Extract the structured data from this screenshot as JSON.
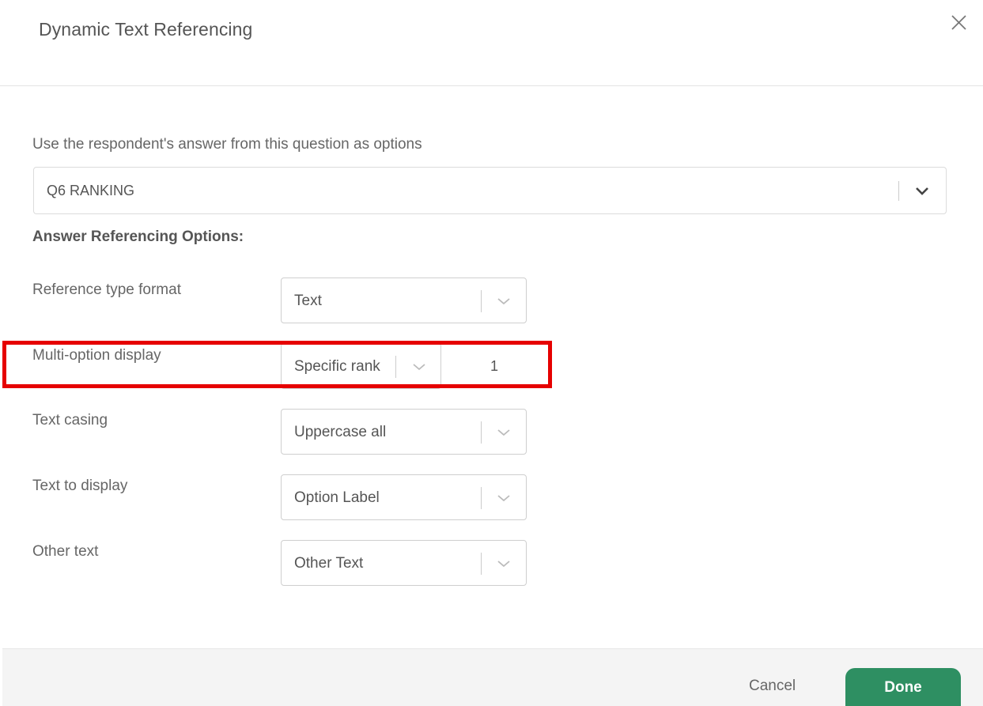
{
  "dialog": {
    "title": "Dynamic Text Referencing",
    "close_icon": "close-icon"
  },
  "question": {
    "label": "Use the respondent's answer from this question as options",
    "selected": "Q6 RANKING"
  },
  "options_section": {
    "title": "Answer Referencing Options:",
    "reference_type": {
      "label": "Reference type format",
      "value": "Text"
    },
    "multi_option": {
      "label": "Multi-option display",
      "value": "Specific rank",
      "rank": "1"
    },
    "text_casing": {
      "label": "Text casing",
      "value": "Uppercase all"
    },
    "text_to_display": {
      "label": "Text to display",
      "value": "Option Label"
    },
    "other_text": {
      "label": "Other text",
      "value": "Other Text"
    }
  },
  "footer": {
    "cancel_label": "Cancel",
    "done_label": "Done"
  },
  "colors": {
    "accent": "#2e8f62",
    "highlight": "#e60000"
  }
}
